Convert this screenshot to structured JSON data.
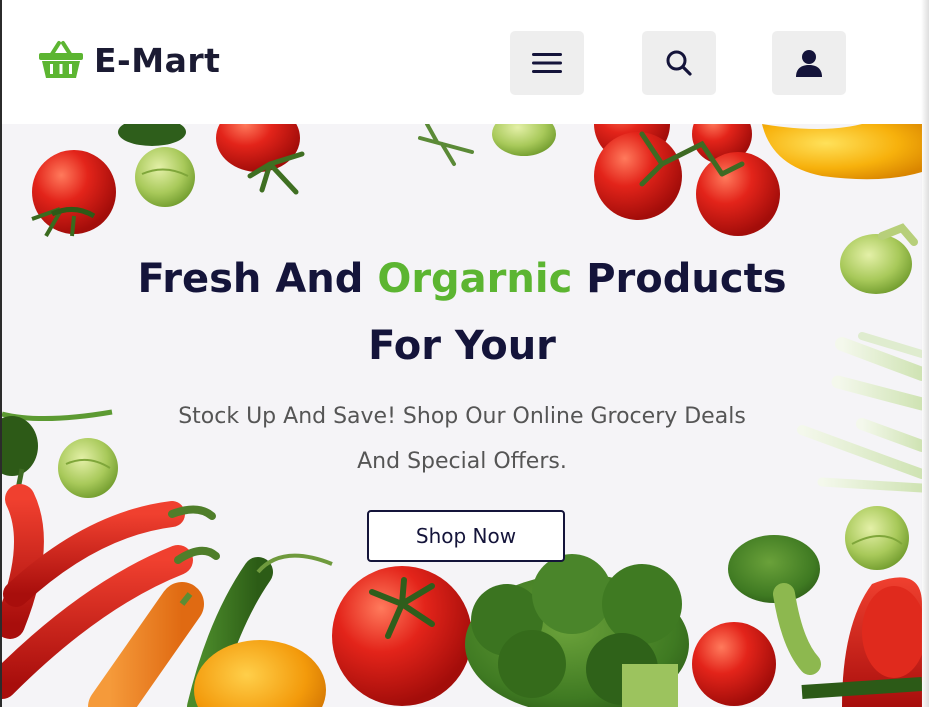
{
  "brand": {
    "name": "E-Mart",
    "logo_icon": "shopping-basket-icon",
    "accent_color": "#5cb531",
    "navy_color": "#14143a"
  },
  "header": {
    "buttons": [
      {
        "name": "menu-button",
        "icon": "hamburger-menu-icon"
      },
      {
        "name": "search-button",
        "icon": "search-icon"
      },
      {
        "name": "account-button",
        "icon": "user-icon"
      }
    ]
  },
  "hero": {
    "title_part1": "Fresh And ",
    "title_highlight": "Orgarnic",
    "title_part2": " Products",
    "title_line2": "For Your",
    "subtitle_line1": "Stock Up And Save! Shop Our Online Grocery Deals",
    "subtitle_line2": "And Special Offers.",
    "cta_label": "Shop Now",
    "background": "fresh vegetables border: tomatoes, chili peppers, broccoli, carrot, bell peppers, brussels sprouts, scallions"
  }
}
